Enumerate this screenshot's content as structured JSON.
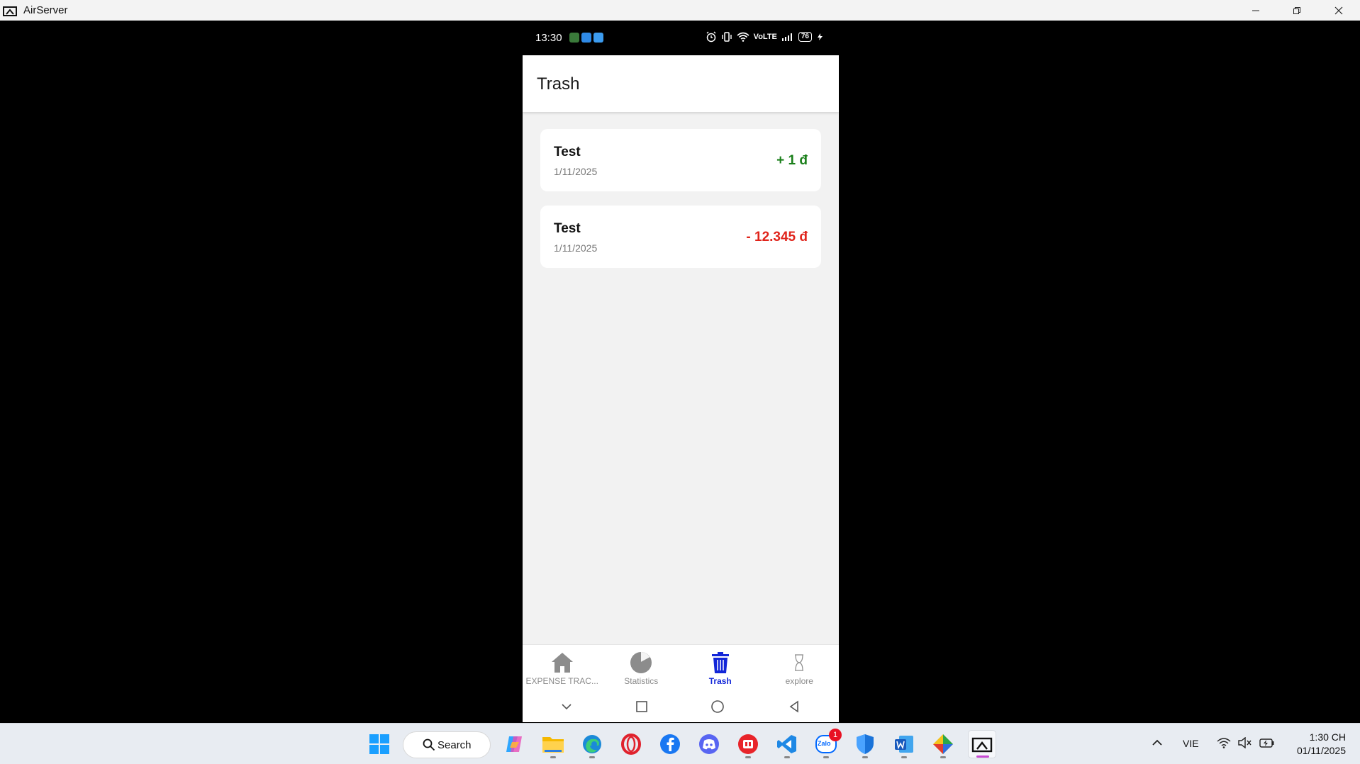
{
  "window": {
    "title": "AirServer",
    "minimize_icon": "minimize-icon",
    "restore_icon": "restore-icon",
    "close_icon": "close-icon"
  },
  "phone_status": {
    "time": "13:30",
    "network": "VoLTE",
    "battery": "76"
  },
  "app": {
    "page_title": "Trash",
    "transactions": [
      {
        "name": "Test",
        "date": "1/11/2025",
        "amount": "+ 1 đ",
        "color": "#1a7f1a"
      },
      {
        "name": "Test",
        "date": "1/11/2025",
        "amount": "- 12.345 đ",
        "color": "#e0241b"
      }
    ],
    "nav": [
      {
        "label": "EXPENSE TRAC...",
        "icon": "home-icon",
        "active": false
      },
      {
        "label": "Statistics",
        "icon": "pie-chart-icon",
        "active": false
      },
      {
        "label": "Trash",
        "icon": "trash-icon",
        "active": true
      },
      {
        "label": "explore",
        "icon": "hourglass-icon",
        "active": false
      }
    ],
    "accent": "#1226d8"
  },
  "taskbar": {
    "search_label": "Search",
    "language": "VIE",
    "time": "1:30 CH",
    "date": "01/11/2025",
    "zalo_badge": "1",
    "zalo_label": "Zalo"
  }
}
